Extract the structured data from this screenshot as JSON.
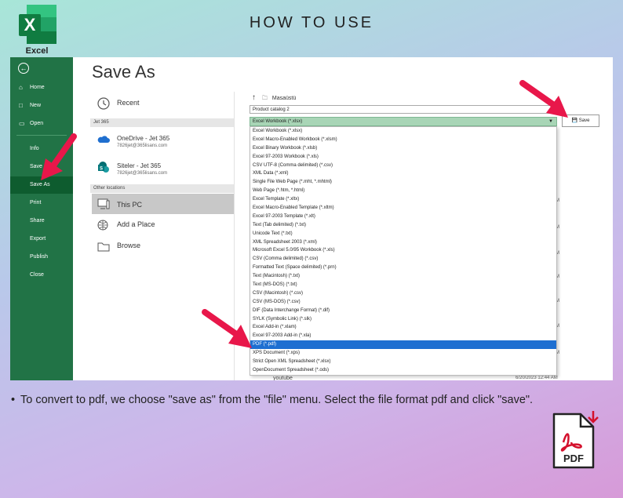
{
  "header": {
    "title": "HOW TO USE",
    "logo_label": "Excel",
    "logo_letter": "X"
  },
  "sidebar": {
    "items": [
      {
        "label": "Home",
        "icon": "home-icon"
      },
      {
        "label": "New",
        "icon": "new-file-icon"
      },
      {
        "label": "Open",
        "icon": "open-folder-icon"
      },
      {
        "label": "Info"
      },
      {
        "label": "Save"
      },
      {
        "label": "Save As"
      },
      {
        "label": "Print"
      },
      {
        "label": "Share"
      },
      {
        "label": "Export"
      },
      {
        "label": "Publish"
      },
      {
        "label": "Close"
      }
    ],
    "active": "Save As"
  },
  "main": {
    "title": "Save As",
    "recent_label": "Recent",
    "group1": "Jet 365",
    "onedrive": {
      "name": "OneDrive - Jet 365",
      "email": "7826jet@365lisans.com"
    },
    "sites": {
      "name": "Siteler - Jet 365",
      "email": "7826jet@365lisans.com"
    },
    "group2": "Other locations",
    "this_pc": "This PC",
    "add_place": "Add a Place",
    "browse": "Browse"
  },
  "save_panel": {
    "path": "Masaüstü",
    "filename": "Product catalog 2",
    "format_selected": "Excel Workbook (*.xlsx)",
    "save_label": "Save",
    "formats": [
      "Excel Workbook (*.xlsx)",
      "Excel Macro-Enabled Workbook (*.xlsm)",
      "Excel Binary Workbook (*.xlsb)",
      "Excel 97-2003 Workbook (*.xls)",
      "CSV UTF-8 (Comma delimited) (*.csv)",
      "XML Data (*.xml)",
      "Single File Web Page (*.mht, *.mhtml)",
      "Web Page (*.htm, *.html)",
      "Excel Template (*.xltx)",
      "Excel Macro-Enabled Template (*.xltm)",
      "Excel 97-2003 Template (*.xlt)",
      "Text (Tab delimited) (*.txt)",
      "Unicode Text (*.txt)",
      "XML Spreadsheet 2003 (*.xml)",
      "Microsoft Excel 5.0/95 Workbook (*.xls)",
      "CSV (Comma delimited) (*.csv)",
      "Formatted Text (Space delimited) (*.prn)",
      "Text (Macintosh) (*.txt)",
      "Text (MS-DOS) (*.txt)",
      "CSV (Macintosh) (*.csv)",
      "CSV (MS-DOS) (*.csv)",
      "DIF (Data Interchange Format) (*.dif)",
      "SYLK (Symbolic Link) (*.slk)",
      "Excel Add-in (*.xlam)",
      "Excel 97-2003 Add-in (*.xla)",
      "PDF (*.pdf)",
      "XPS Document (*.xps)",
      "Strict Open XML Spreadsheet (*.xlsx)",
      "OpenDocument Spreadsheet (*.ods)"
    ],
    "highlighted_index": 25,
    "bg_file_name": "youtube",
    "bg_file_date": "6/20/2023 12:44 AM",
    "bg_m": "M"
  },
  "instructions": "To convert to pdf, we choose \"save as\" from the \"file\" menu. Select the file format pdf and click \"save\".",
  "pdf_badge": "PDF",
  "colors": {
    "excel_green": "#217346",
    "active_green": "#0e5c2f",
    "arrow_red": "#e8174a",
    "highlight_blue": "#1e6fd1",
    "pdf_red": "#d4102c"
  }
}
